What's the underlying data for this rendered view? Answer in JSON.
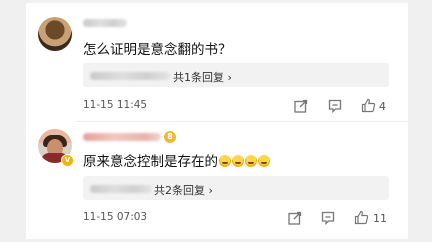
{
  "comments": [
    {
      "text": "怎么证明是意念翻的书？",
      "reply_summary": "共1条回复",
      "reply_arrow": "›",
      "time": "11-15 11:45",
      "like_count": "4"
    },
    {
      "text": "原来意念控制是存在的",
      "level_badge": "8",
      "verified_badge": "V",
      "reply_summary": "共2条回复",
      "reply_arrow": "›",
      "time": "11-15 07:03",
      "like_count": "11"
    }
  ]
}
